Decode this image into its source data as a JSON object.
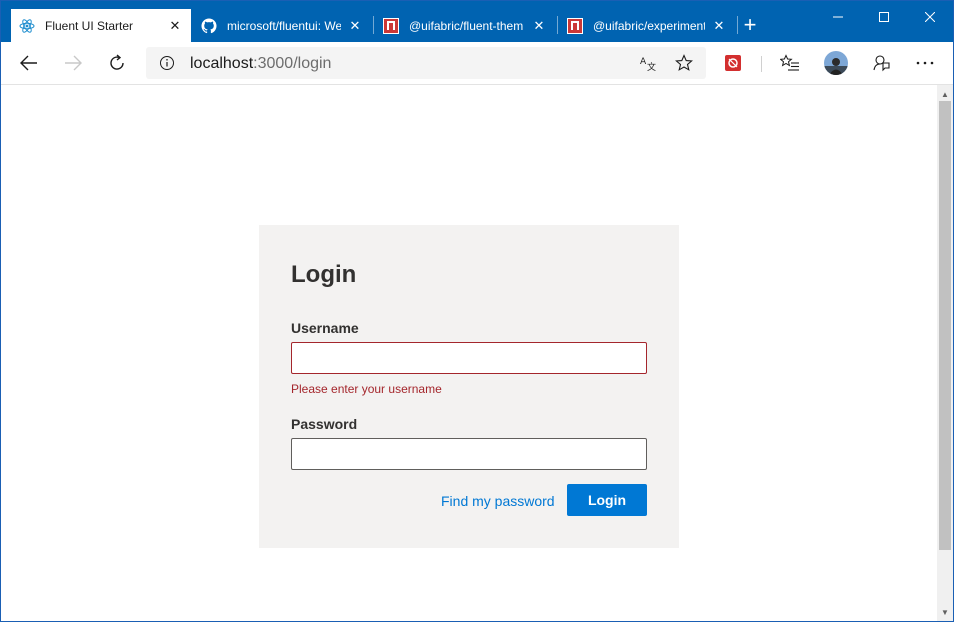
{
  "browser": {
    "tabs": [
      {
        "title": "Fluent UI Starter",
        "icon": "react-icon",
        "active": true
      },
      {
        "title": "microsoft/fluentui: We",
        "icon": "github-icon",
        "active": false
      },
      {
        "title": "@uifabric/fluent-them",
        "icon": "npm-icon",
        "active": false
      },
      {
        "title": "@uifabric/experiment",
        "icon": "npm-icon",
        "active": false
      }
    ],
    "close_glyph": "✕",
    "new_tab_glyph": "+",
    "window_controls": {
      "minimize": "—",
      "maximize": "☐",
      "close": "✕"
    },
    "address": {
      "host": "localhost",
      "path": ":3000/login"
    },
    "colors": {
      "titlebar": "#0063b1",
      "accent": "#0078d4",
      "error": "#a4262c"
    }
  },
  "login": {
    "title": "Login",
    "username_label": "Username",
    "username_value": "",
    "username_error": "Please enter your username",
    "password_label": "Password",
    "password_value": "",
    "forgot_link": "Find my password",
    "submit_label": "Login"
  }
}
